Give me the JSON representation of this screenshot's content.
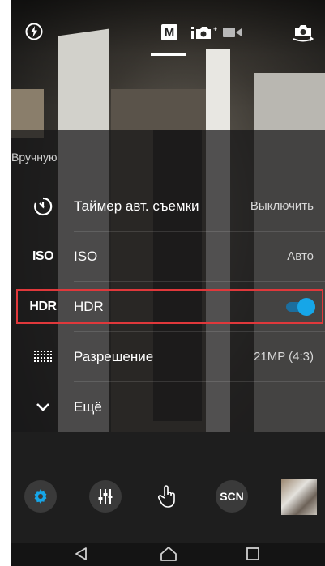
{
  "top_bar": {
    "flash_icon": "flash-auto-icon",
    "mode_manual_badge": "M",
    "photo_mode_icon": "camera-photo-icon",
    "video_mode_icon": "video-camera-icon",
    "switch_camera_icon": "switch-camera-icon"
  },
  "settings": {
    "section_title": "Вручную",
    "rows": [
      {
        "icon": "timer-icon",
        "label": "Таймер авт. съемки",
        "value": "Выключить"
      },
      {
        "icon_text": "ISO",
        "label": "ISO",
        "value": "Авто"
      },
      {
        "icon_text": "HDR",
        "label": "HDR",
        "toggle_on": true
      },
      {
        "icon": "grid-resolution-icon",
        "label": "Разрешение",
        "value": "21MP (4:3)"
      },
      {
        "icon": "chevron-down-icon",
        "label": "Ещё"
      }
    ]
  },
  "controls": {
    "settings_icon": "gear-icon",
    "filters_icon": "sliders-icon",
    "touch_icon": "touch-hand-icon",
    "scene_label": "SCN",
    "gallery_icon": "gallery-thumbnail"
  },
  "nav": {
    "back_icon": "back-triangle-icon",
    "home_icon": "home-icon",
    "recents_icon": "recents-square-icon"
  },
  "colors": {
    "accent": "#16a6e8",
    "highlight_border": "#e0383b"
  }
}
